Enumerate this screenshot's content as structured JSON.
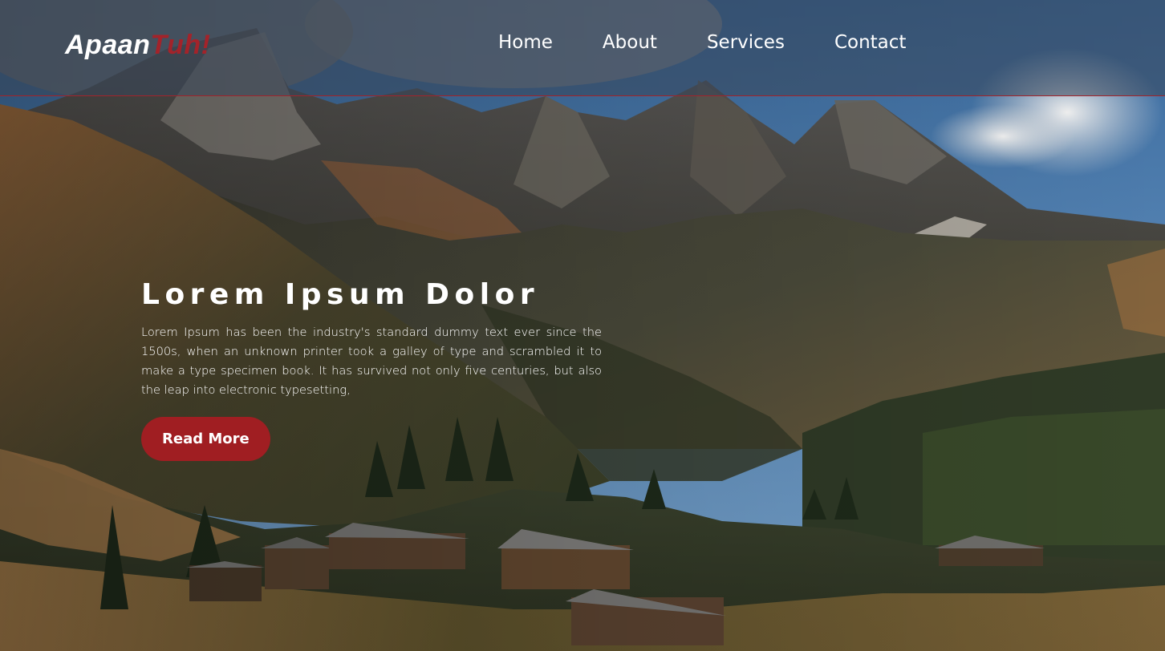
{
  "brand": {
    "primary": "Apaan",
    "accent": "Tuh!",
    "accent_color": "#a3232a"
  },
  "nav": {
    "items": [
      {
        "label": "Home"
      },
      {
        "label": "About"
      },
      {
        "label": "Services"
      },
      {
        "label": "Contact"
      }
    ]
  },
  "hero": {
    "title": "Lorem Ipsum Dolor",
    "text": "Lorem Ipsum has been the industry's standard dummy text ever since the 1500s, when an unknown printer took a galley of type and scrambled it to make a type specimen book. It has survived not only five centuries, but also the leap into electronic typesetting,",
    "button_label": "Read More",
    "button_color": "#a01e22",
    "background": "mountain-valley-landscape-image"
  }
}
